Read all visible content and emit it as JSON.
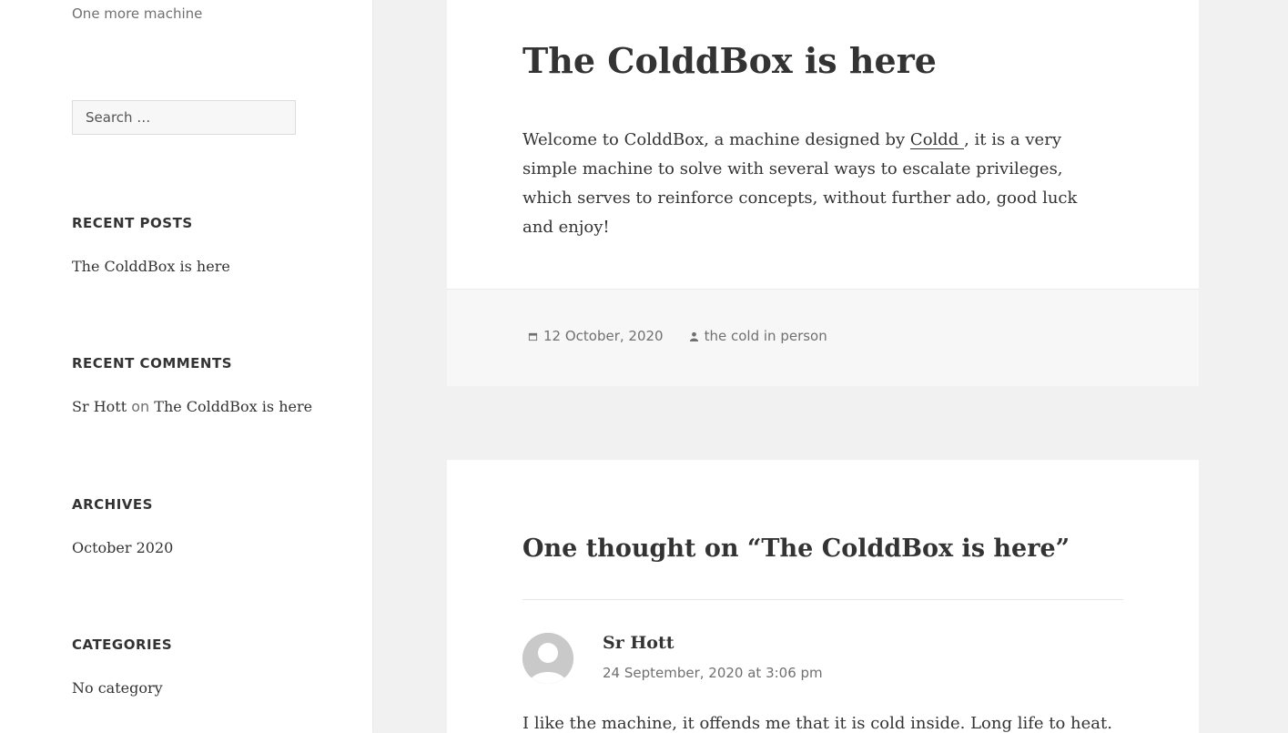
{
  "sidebar": {
    "tagline": "One more machine",
    "search_placeholder": "Search …",
    "recent_posts": {
      "title": "RECENT POSTS",
      "items": [
        "The ColddBox is here"
      ]
    },
    "recent_comments": {
      "title": "RECENT COMMENTS",
      "author": "Sr Hott",
      "on": "on",
      "post": "The ColddBox is here"
    },
    "archives": {
      "title": "ARCHIVES",
      "items": [
        "October 2020"
      ]
    },
    "categories": {
      "title": "CATEGORIES",
      "items": [
        "No category"
      ]
    }
  },
  "post": {
    "title": "The ColddBox is here",
    "body_before_link": "Welcome to ColddBox, a machine designed by ",
    "link_text": "Coldd ",
    "body_after_link": ", it is a very simple machine to solve with several ways to escalate privileges, which serves to reinforce concepts, without further ado, good luck and enjoy!",
    "date": "12 October, 2020",
    "author": "the cold in person",
    "date_icon": "calendar-icon",
    "author_icon": "person-icon"
  },
  "comments": {
    "title": "One thought on “The ColddBox is here”",
    "items": [
      {
        "author": "Sr Hott",
        "date": "24 September, 2020 at 3:06 pm",
        "text": "I like the machine, it offends me that it is cold inside. Long life to heat."
      }
    ]
  }
}
